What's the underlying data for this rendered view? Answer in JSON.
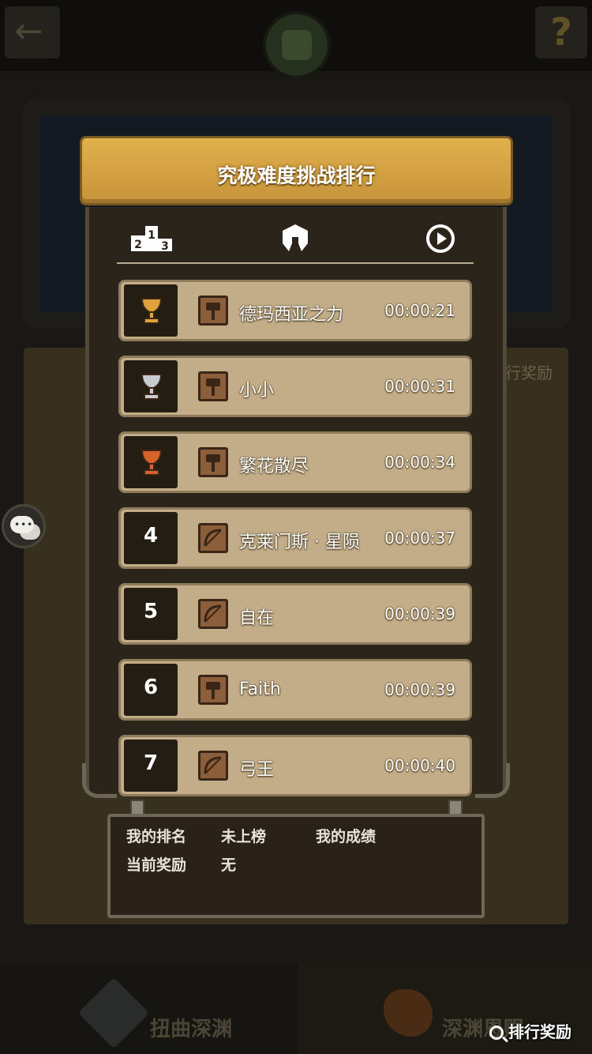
{
  "modal": {
    "title": "究极难度挑战排行",
    "tabs": [
      {
        "icon": "podium-icon"
      },
      {
        "icon": "helmet-icon"
      },
      {
        "icon": "clock-icon"
      }
    ]
  },
  "leaderboard": [
    {
      "rank": "",
      "medal": "gold",
      "class_icon": "hammer-class-icon",
      "name": "德玛西亚之力",
      "time": "00:00:21"
    },
    {
      "rank": "",
      "medal": "silver",
      "class_icon": "hammer-class-icon",
      "name": "小小",
      "time": "00:00:31"
    },
    {
      "rank": "",
      "medal": "bronze",
      "class_icon": "hammer-class-icon",
      "name": "繁花散尽",
      "time": "00:00:34"
    },
    {
      "rank": "4",
      "medal": "",
      "class_icon": "bow-class-icon",
      "name": "克莱门斯 · 星陨",
      "time": "00:00:37"
    },
    {
      "rank": "5",
      "medal": "",
      "class_icon": "bow-class-icon",
      "name": "自在",
      "time": "00:00:39"
    },
    {
      "rank": "6",
      "medal": "",
      "class_icon": "hammer-class-icon",
      "name": "Faith",
      "time": "00:00:39"
    },
    {
      "rank": "7",
      "medal": "",
      "class_icon": "bow-class-icon",
      "name": "弓王",
      "time": "00:00:40"
    }
  ],
  "my_status": {
    "rank_label": "我的排名",
    "rank_value": "未上榜",
    "score_label": "我的成绩",
    "reward_label": "当前奖励",
    "reward_value": "无"
  },
  "background": {
    "side_label": "行奖励",
    "tab_left": "扭曲深渊",
    "tab_right": "深渊恩赐"
  },
  "reward_button": "排行奖励",
  "colors": {
    "header_gold": "#d6a445",
    "row_bg": "#c2ad88",
    "rank_box": "#241d14",
    "gold_medal": "#e0a23a",
    "silver_medal": "#c8ccd0",
    "bronze_medal": "#d8632a"
  }
}
